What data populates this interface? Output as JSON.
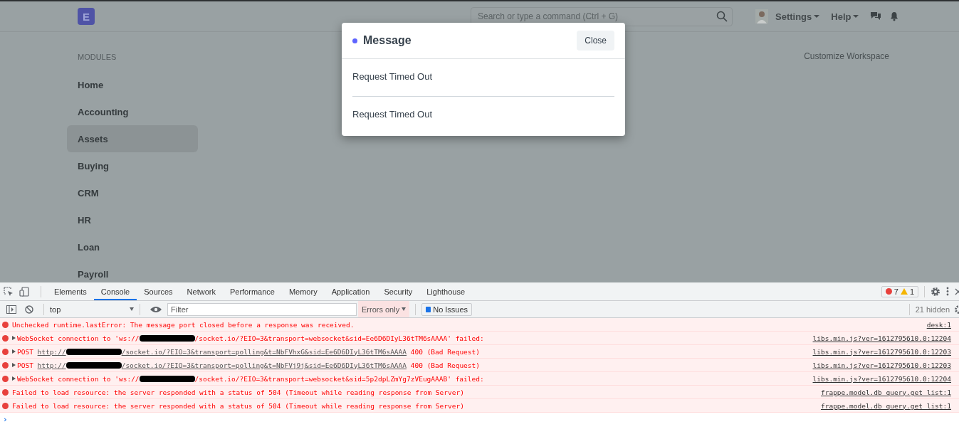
{
  "navbar": {
    "logo": "E",
    "search": {
      "placeholder": "Search or type a command (Ctrl + G)"
    },
    "menus": [
      {
        "label": "Settings"
      },
      {
        "label": "Help"
      }
    ]
  },
  "sidebar": {
    "heading": "MODULES",
    "items": [
      {
        "label": "Home",
        "selected": false
      },
      {
        "label": "Accounting",
        "selected": false
      },
      {
        "label": "Assets",
        "selected": true
      },
      {
        "label": "Buying",
        "selected": false
      },
      {
        "label": "CRM",
        "selected": false
      },
      {
        "label": "HR",
        "selected": false
      },
      {
        "label": "Loan",
        "selected": false
      },
      {
        "label": "Payroll",
        "selected": false
      }
    ]
  },
  "customize_link": "Customize Workspace",
  "modal": {
    "title": "Message",
    "close": "Close",
    "messages": [
      "Request Timed Out",
      "Request Timed Out"
    ]
  },
  "devtools": {
    "tabs": [
      {
        "label": "Elements",
        "selected": false
      },
      {
        "label": "Console",
        "selected": true
      },
      {
        "label": "Sources",
        "selected": false
      },
      {
        "label": "Network",
        "selected": false
      },
      {
        "label": "Performance",
        "selected": false
      },
      {
        "label": "Memory",
        "selected": false
      },
      {
        "label": "Application",
        "selected": false
      },
      {
        "label": "Security",
        "selected": false
      },
      {
        "label": "Lighthouse",
        "selected": false
      }
    ],
    "error_count": "7",
    "warning_count": "1",
    "context": "top",
    "filter": {
      "placeholder": "Filter"
    },
    "levels": "Errors only",
    "issues": "No Issues",
    "hidden": "21 hidden",
    "messages": [
      {
        "expandable": false,
        "parts": [
          {
            "kind": "text",
            "text": "Unchecked runtime.lastError: The message port closed before a response was received."
          }
        ],
        "source": "desk:1"
      },
      {
        "expandable": true,
        "parts": [
          {
            "kind": "text",
            "text": "WebSocket connection to 'ws://"
          },
          {
            "kind": "redacted"
          },
          {
            "kind": "text",
            "text": "/socket.io/?EIO=3&transport=websocket&sid=Ee6D6DIyL36tTM6sAAAA' failed:"
          }
        ],
        "source": "libs.min.js?ver=1612795610.0:12204"
      },
      {
        "expandable": true,
        "parts": [
          {
            "kind": "text",
            "text": "POST "
          },
          {
            "kind": "link",
            "text": "http://"
          },
          {
            "kind": "redacted"
          },
          {
            "kind": "link",
            "text": "/socket.io/?EIO=3&transport=polling&t=NbFVhxG&sid=Ee6D6DIyL36tTM6sAAAA"
          },
          {
            "kind": "text",
            "text": " 400 (Bad Request)"
          }
        ],
        "source": "libs.min.js?ver=1612795610.0:12203"
      },
      {
        "expandable": true,
        "parts": [
          {
            "kind": "text",
            "text": "POST "
          },
          {
            "kind": "link",
            "text": "http://"
          },
          {
            "kind": "redacted"
          },
          {
            "kind": "link",
            "text": "/socket.io/?EIO=3&transport=polling&t=NbFVj9j&sid=Ee6D6DIyL36tTM6sAAAA"
          },
          {
            "kind": "text",
            "text": " 400 (Bad Request)"
          }
        ],
        "source": "libs.min.js?ver=1612795610.0:12203"
      },
      {
        "expandable": true,
        "parts": [
          {
            "kind": "text",
            "text": "WebSocket connection to 'ws://"
          },
          {
            "kind": "redacted"
          },
          {
            "kind": "text",
            "text": "/socket.io/?EIO=3&transport=websocket&sid=5p2dpLZmYg7zVEugAAAB' failed:"
          }
        ],
        "source": "libs.min.js?ver=1612795610.0:12204"
      },
      {
        "expandable": false,
        "parts": [
          {
            "kind": "text",
            "text": "Failed to load resource: the server responded with a status of 504 (Timeout while reading response from Server)"
          }
        ],
        "source": "frappe.model.db_query.get_list:1"
      },
      {
        "expandable": false,
        "parts": [
          {
            "kind": "text",
            "text": "Failed to load resource: the server responded with a status of 504 (Timeout while reading response from Server)"
          }
        ],
        "source": "frappe.model.db_query.get_list:1"
      }
    ],
    "prompt": "›"
  }
}
